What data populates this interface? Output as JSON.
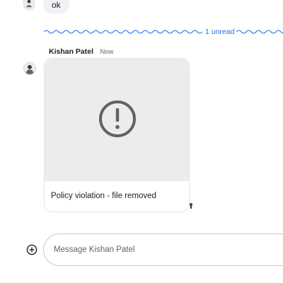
{
  "previous_message": {
    "text": "ok"
  },
  "divider": {
    "label": "1 unread",
    "color": "#1a73e8"
  },
  "message": {
    "sender": "Kishan Patel",
    "time": "Now",
    "attachment": {
      "status_icon": "exclamation-circle-icon",
      "caption": "Policy violation - file removed"
    }
  },
  "composer": {
    "add_icon": "plus-circle-icon",
    "placeholder": "Message Kishan Patel"
  }
}
